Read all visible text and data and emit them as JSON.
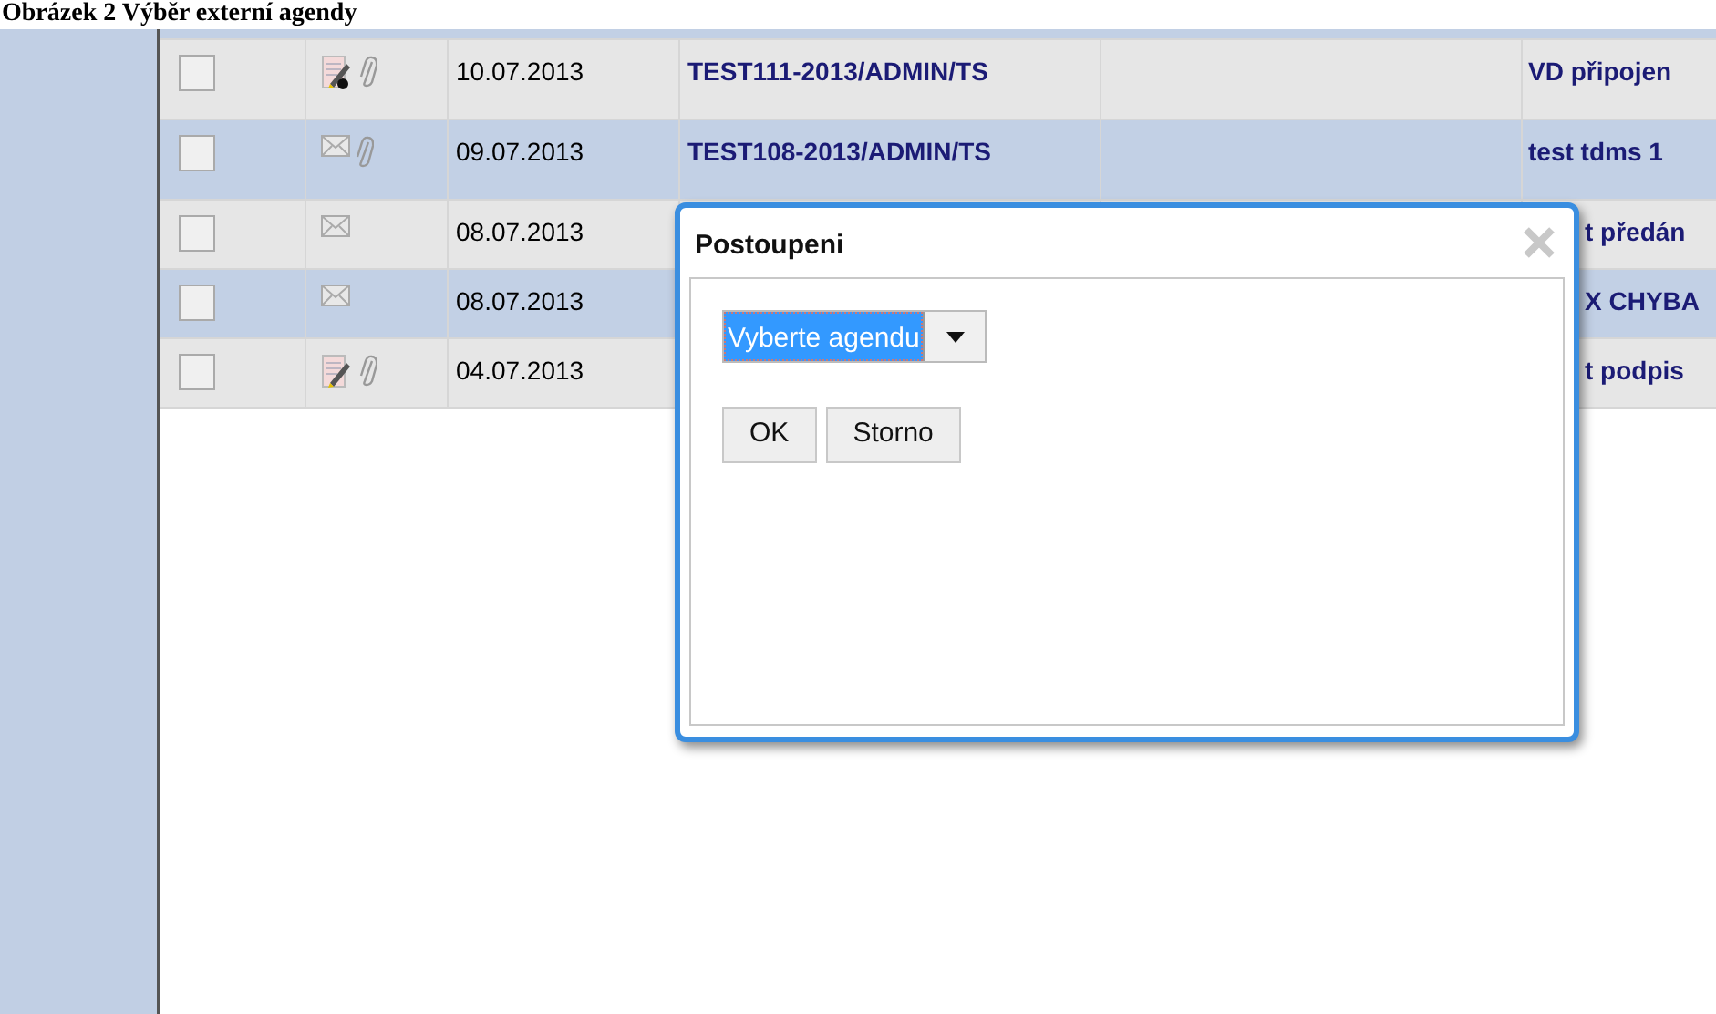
{
  "caption": "Obrázek 2 Výběr externí agendy",
  "table": {
    "rows": [
      {
        "checked": false,
        "icons": [
          {
            "kind": "document-e"
          },
          {
            "kind": "clip"
          }
        ],
        "date": "10.07.2013",
        "reference": "TEST111-2013/ADMIN/TS",
        "subject": "VD připojen",
        "highlighted": false
      },
      {
        "checked": false,
        "icons": [
          {
            "kind": "mail"
          },
          {
            "kind": "clip"
          }
        ],
        "date": "09.07.2013",
        "reference": "TEST108-2013/ADMIN/TS",
        "subject": "test tdms 1",
        "highlighted": true
      },
      {
        "checked": false,
        "icons": [
          {
            "kind": "mail"
          }
        ],
        "date": "08.07.2013",
        "subject": "t předán",
        "highlighted": false
      },
      {
        "checked": false,
        "icons": [
          {
            "kind": "mail"
          }
        ],
        "date": "08.07.2013",
        "subject": "X CHYBA",
        "highlighted": true
      },
      {
        "checked": false,
        "icons": [
          {
            "kind": "document"
          },
          {
            "kind": "clip"
          }
        ],
        "date": "04.07.2013",
        "subject": "t podpis",
        "highlighted": false
      }
    ]
  },
  "dialog": {
    "title": "Postoupeni",
    "select": {
      "value": "Vyberte agendu"
    },
    "buttons": [
      "OK",
      "Storno"
    ]
  }
}
